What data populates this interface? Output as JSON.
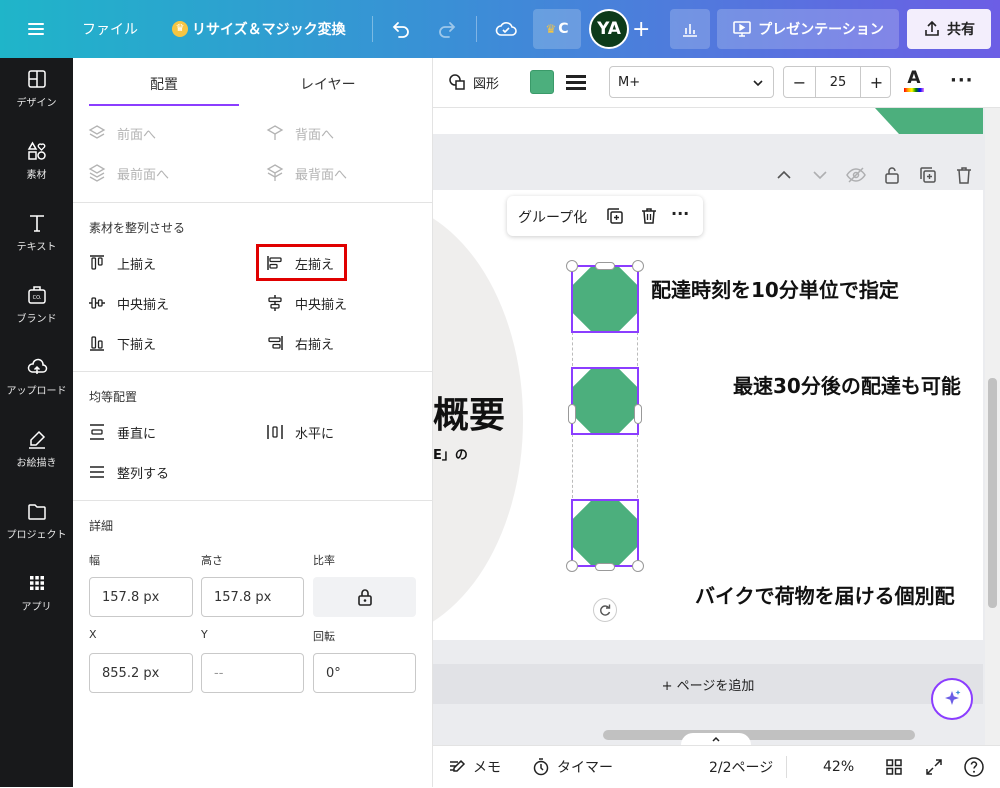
{
  "topbar": {
    "menu_icon": "hamburger-icon",
    "file_label": "ファイル",
    "resize_label": "リサイズ＆マジック変換",
    "crown_badge_label": "C",
    "avatar_initials": "YA",
    "present_label": "プレゼンテーション",
    "share_label": "共有"
  },
  "rail": {
    "items": [
      {
        "label": "デザイン",
        "icon": "layout-icon"
      },
      {
        "label": "素材",
        "icon": "shapes-icon"
      },
      {
        "label": "テキスト",
        "icon": "text-icon"
      },
      {
        "label": "ブランド",
        "icon": "brand-icon"
      },
      {
        "label": "アップロード",
        "icon": "cloud-upload-icon"
      },
      {
        "label": "お絵描き",
        "icon": "draw-icon"
      },
      {
        "label": "プロジェクト",
        "icon": "folder-icon"
      },
      {
        "label": "アプリ",
        "icon": "apps-grid-icon"
      }
    ]
  },
  "panel": {
    "tabs": [
      "配置",
      "レイヤー"
    ],
    "layer": {
      "forward": "前面へ",
      "backward": "背面へ",
      "to_front": "最前面へ",
      "to_back": "最背面へ"
    },
    "align": {
      "title": "素材を整列させる",
      "top": "上揃え",
      "left": "左揃え",
      "middle": "中央揃え",
      "center": "中央揃え",
      "bottom": "下揃え",
      "right": "右揃え"
    },
    "distribute": {
      "title": "均等配置",
      "vertical": "垂直に",
      "horizontal": "水平に",
      "tidy": "整列する"
    },
    "details": {
      "title": "詳細",
      "width_label": "幅",
      "width_value": "157.8 px",
      "height_label": "高さ",
      "height_value": "157.8 px",
      "ratio_label": "比率",
      "x_label": "X",
      "x_value": "855.2 px",
      "y_label": "Y",
      "y_value": "--",
      "rotation_label": "回転",
      "rotation_value": "0°"
    }
  },
  "toolbar": {
    "shape_label": "図形",
    "fill_color": "#4caf7d",
    "font_value": "M+",
    "font_size": "25"
  },
  "canvas": {
    "group_label": "グループ化",
    "text1": "配達時刻を10分単位で指定",
    "text2": "最速30分後の配達も可能",
    "text3": "バイクで荷物を届ける個別配",
    "title_partial": "概要",
    "subtitle_partial": "E」の",
    "add_page_label": "+ ページを追加"
  },
  "bottombar": {
    "memo_label": "メモ",
    "timer_label": "タイマー",
    "page_label": "2/2ページ",
    "zoom_label": "42%"
  },
  "colors": {
    "accent_purple": "#8b3dff",
    "shape_green": "#4caf7d",
    "highlight_red": "#e00000"
  }
}
